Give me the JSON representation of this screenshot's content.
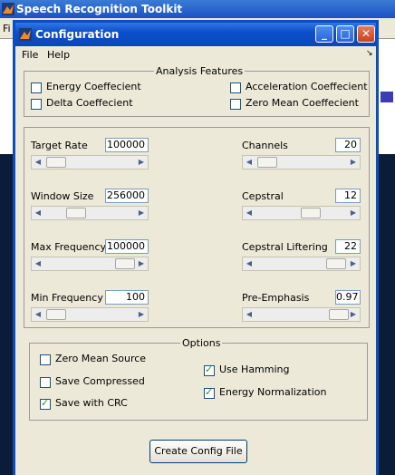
{
  "background_app": {
    "title": "Speech Recognition Toolkit",
    "menu_label": "Fi"
  },
  "dialog": {
    "title": "Configuration",
    "menu": [
      "File",
      "Help"
    ],
    "menu_arrow": "↘",
    "buttons": {
      "minimize": "_",
      "maximize": "□",
      "close": "✕"
    }
  },
  "analysis_features": {
    "title": "Analysis Features",
    "items": [
      {
        "label": "Energy Coeffecient",
        "checked": false
      },
      {
        "label": "Delta Coeffecient",
        "checked": false
      },
      {
        "label": "Acceleration Coeffecient",
        "checked": false
      },
      {
        "label": "Zero Mean Coeffecient",
        "checked": false
      }
    ]
  },
  "params": [
    {
      "label": "Target Rate",
      "value": "100000",
      "slider_fraction": 0.05
    },
    {
      "label": "Window Size",
      "value": "256000",
      "slider_fraction": 0.25
    },
    {
      "label": "Max Frequency",
      "value": "100000",
      "slider_fraction": 1.0
    },
    {
      "label": "Min Frequency",
      "value": "100",
      "slider_fraction": 0.05
    },
    {
      "label": "Channels",
      "value": "20",
      "slider_fraction": 0.12
    },
    {
      "label": "Cepstral",
      "value": "12",
      "slider_fraction": 0.55
    },
    {
      "label": "Cepstral Liftering",
      "value": "22",
      "slider_fraction": 0.95
    },
    {
      "label": "Pre-Emphasis",
      "value": "0.97",
      "slider_fraction": 0.97
    }
  ],
  "options": {
    "title": "Options",
    "items": [
      {
        "label": "Zero Mean Source",
        "checked": false
      },
      {
        "label": "Save Compressed",
        "checked": false
      },
      {
        "label": "Save with CRC",
        "checked": true
      },
      {
        "label": "Use Hamming",
        "checked": true
      },
      {
        "label": "Energy Normalization",
        "checked": true
      }
    ]
  },
  "create_button": "Create Config File",
  "colors": {
    "title_blue": "#0b46ba",
    "face": "#ece9d8",
    "check_green": "#21a121"
  }
}
